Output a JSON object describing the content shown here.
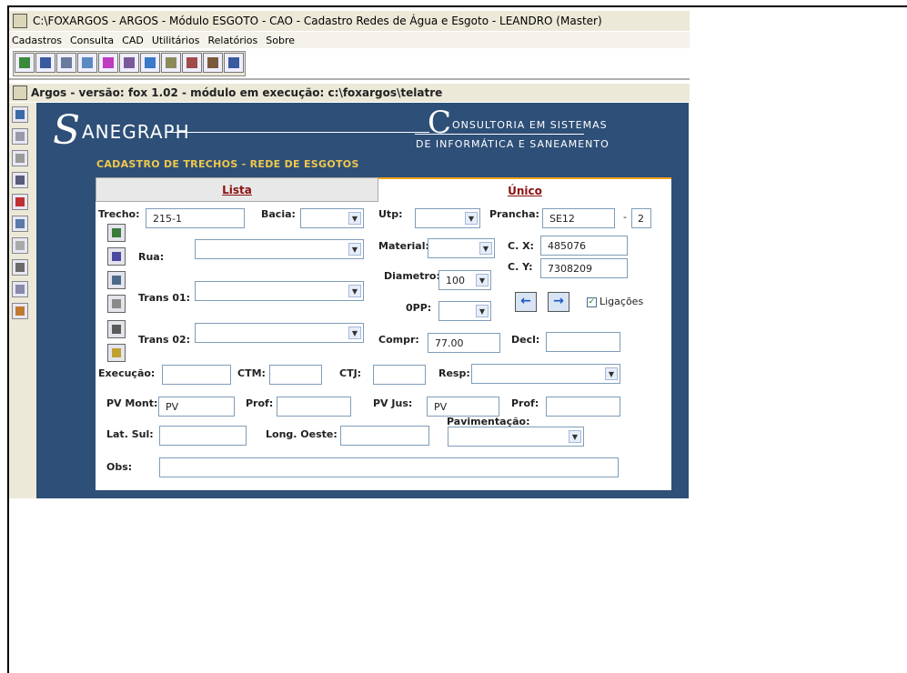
{
  "window": {
    "title": "C:\\FOXARGOS - ARGOS - Módulo ESGOTO - CAO - Cadastro Redes de Água e Esgoto - LEANDRO (Master)"
  },
  "menu": [
    "Cadastros",
    "Consulta",
    "CAD",
    "Utilitários",
    "Relatórios",
    "Sobre"
  ],
  "subwindow": {
    "title": "Argos - versão: fox 1.02 - módulo em execução: c:\\foxargos\\telatre"
  },
  "logo": {
    "initial": "S",
    "name": "ANEGRAPH",
    "cons_initial": "C",
    "cons_line1": "ONSULTORIA EM SISTEMAS",
    "cons_line2": "DE INFORMÁTICA E SANEAMENTO"
  },
  "form": {
    "section_title": "CADASTRO DE TRECHOS - REDE DE ESGOTOS",
    "tabs": {
      "lista": "Lista",
      "unico": "Único"
    },
    "trecho": {
      "label": "Trecho:",
      "value": "215-1"
    },
    "bacia": {
      "label": "Bacia:",
      "value": ""
    },
    "utp": {
      "label": "Utp:",
      "value": ""
    },
    "prancha": {
      "label": "Prancha:",
      "value": "SE12",
      "dash": "-",
      "suffix": "2"
    },
    "rua": {
      "label": "Rua:",
      "value": ""
    },
    "material": {
      "label": "Material:",
      "value": ""
    },
    "cx": {
      "label": "C. X:",
      "value": "485076"
    },
    "cy": {
      "label": "C. Y:",
      "value": "7308209"
    },
    "diametro": {
      "label": "Diametro:",
      "value": "100"
    },
    "trans01": {
      "label": "Trans 01:",
      "value": ""
    },
    "opp": {
      "label": "0PP:",
      "value": ""
    },
    "ligacoes": {
      "label": "Ligações",
      "checked": true
    },
    "trans02": {
      "label": "Trans 02:",
      "value": ""
    },
    "compr": {
      "label": "Compr:",
      "value": "77.00"
    },
    "decl": {
      "label": "Decl:",
      "value": ""
    },
    "execucao": {
      "label": "Execução:",
      "value": ""
    },
    "ctm": {
      "label": "CTM:",
      "value": ""
    },
    "ctj": {
      "label": "CTJ:",
      "value": ""
    },
    "resp": {
      "label": "Resp:",
      "value": ""
    },
    "pv_mont": {
      "label": "PV Mont:",
      "value": "PV"
    },
    "prof1": {
      "label": "Prof:",
      "value": ""
    },
    "pv_jus": {
      "label": "PV Jus:",
      "value": "PV"
    },
    "prof2": {
      "label": "Prof:",
      "value": ""
    },
    "lat_sul": {
      "label": "Lat. Sul:",
      "value": ""
    },
    "long_oeste": {
      "label": "Long. Oeste:",
      "value": ""
    },
    "pavimentacao": {
      "label": "Pavimentação:",
      "value": ""
    },
    "obs": {
      "label": "Obs:",
      "value": ""
    }
  }
}
